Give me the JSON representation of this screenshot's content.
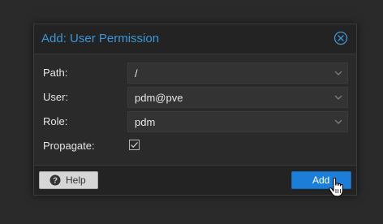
{
  "dialog": {
    "title": "Add: User Permission",
    "close_icon": "close-circle-icon",
    "accent_color": "#3c96d8"
  },
  "form": {
    "path": {
      "label": "Path:",
      "value": "/"
    },
    "user": {
      "label": "User:",
      "value": "pdm@pve"
    },
    "role": {
      "label": "Role:",
      "value": "pdm"
    },
    "propagate": {
      "label": "Propagate:",
      "checked": true
    }
  },
  "footer": {
    "help_label": "Help",
    "help_icon": "question-circle-icon",
    "add_label": "Add",
    "add_color": "#1c7ed6"
  },
  "cursor": {
    "type": "hand-pointer-icon"
  }
}
